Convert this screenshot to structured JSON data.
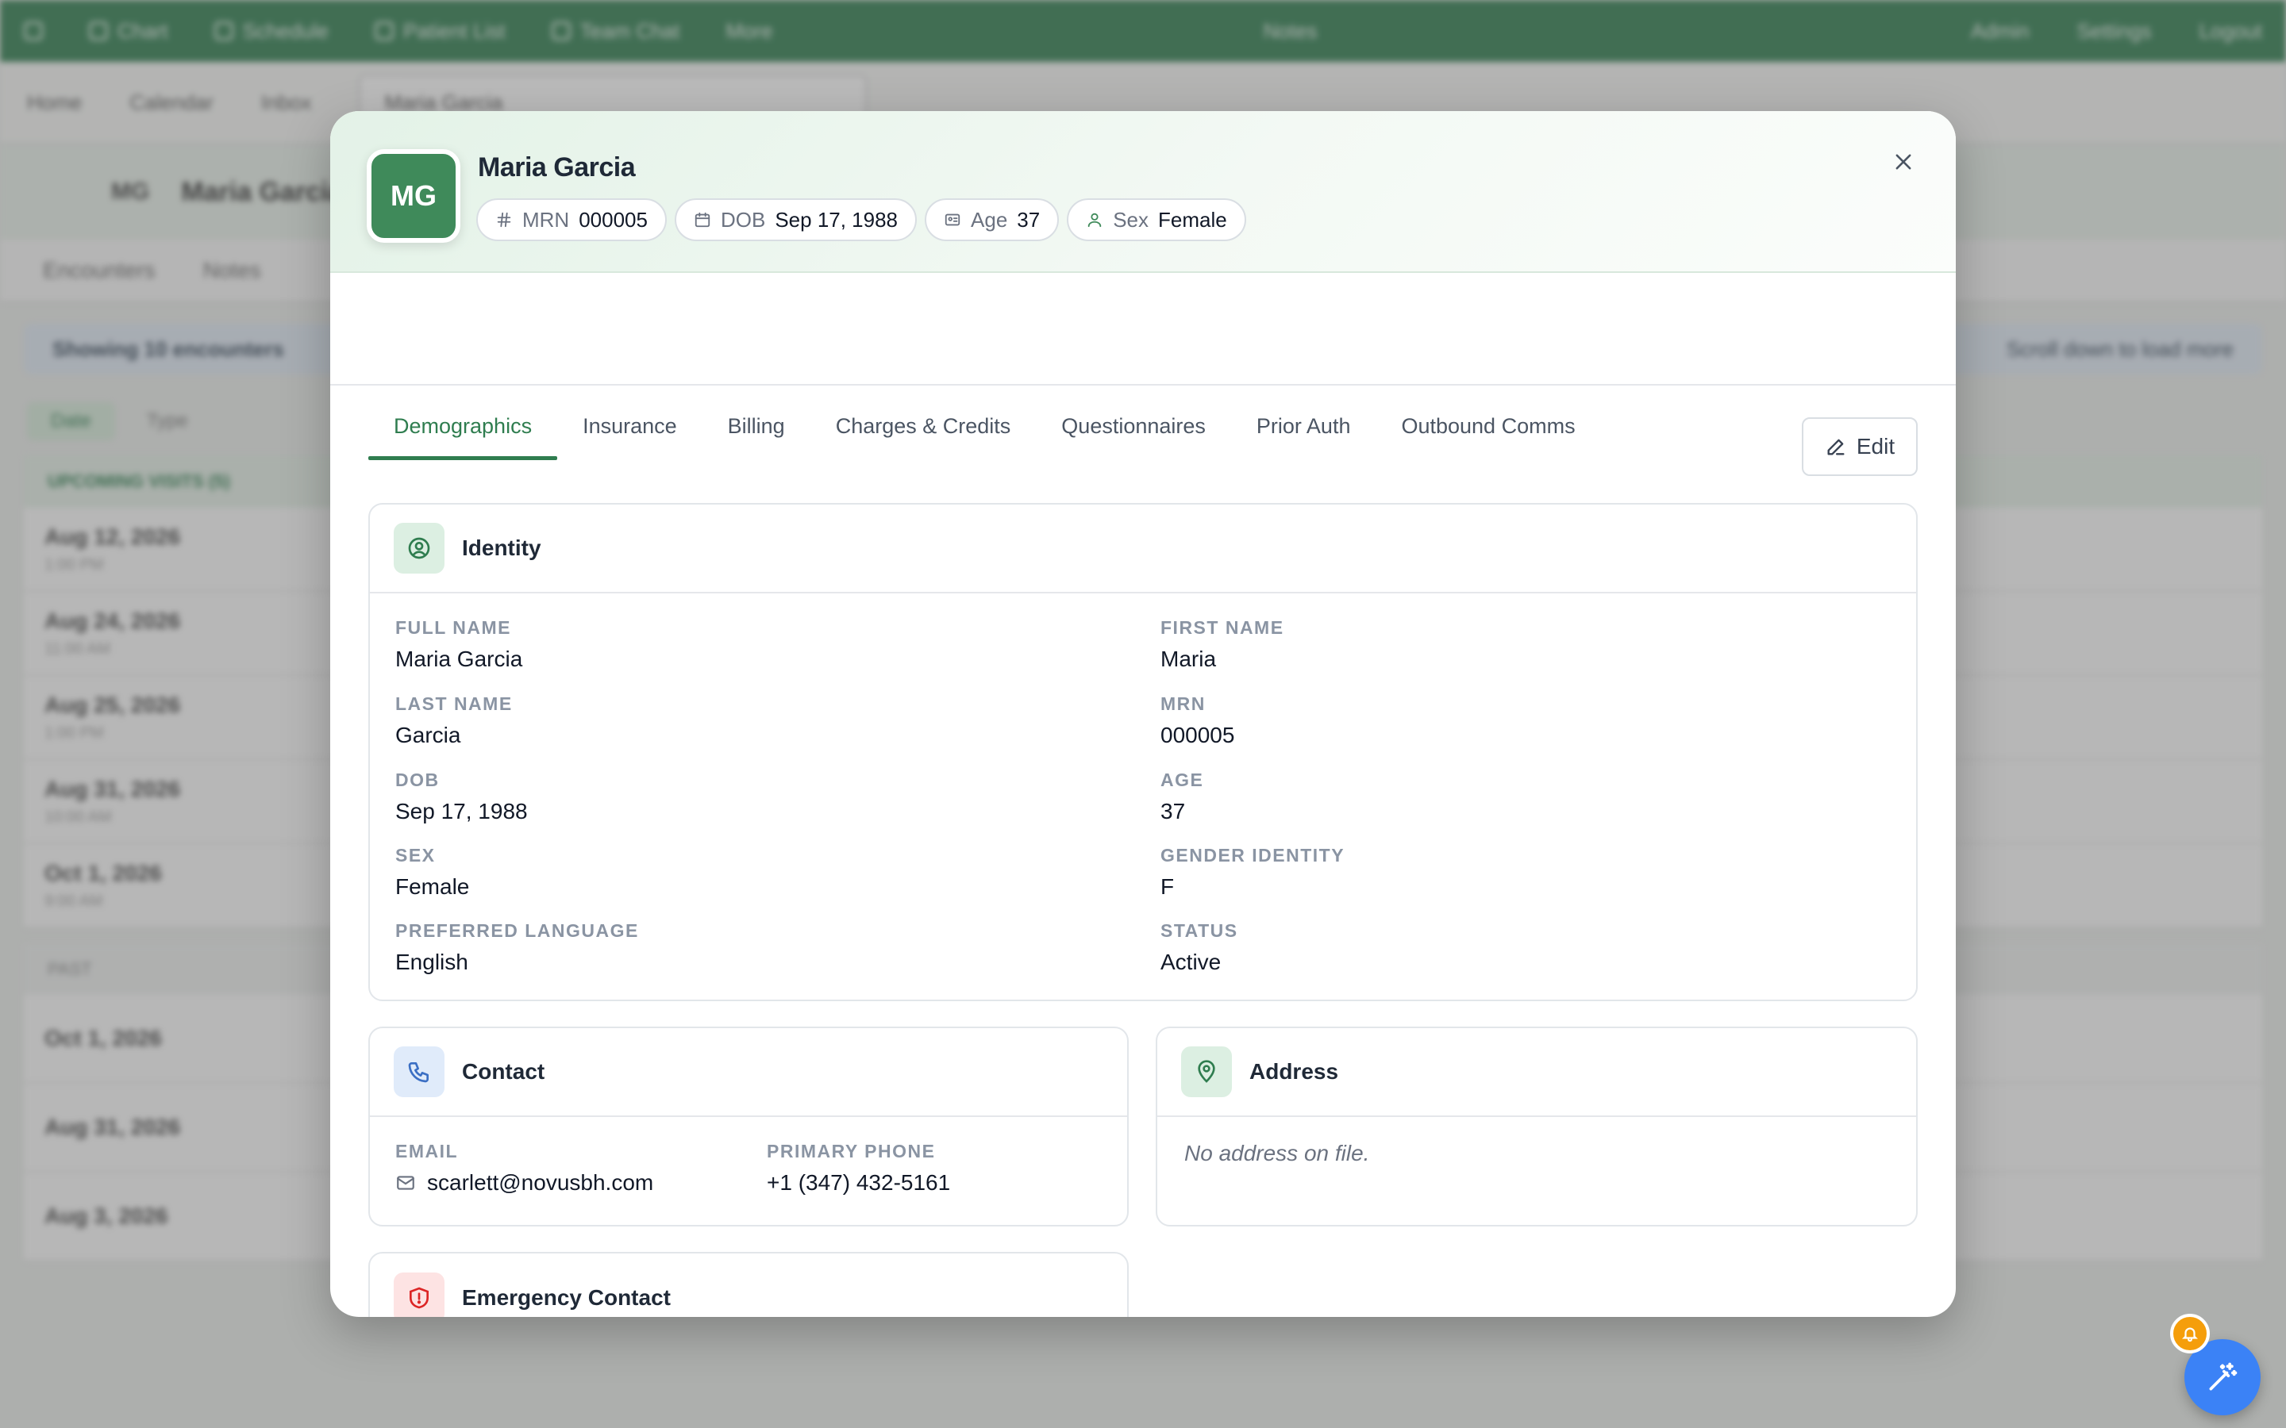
{
  "background": {
    "nav": [
      "Chart",
      "Schedule",
      "Patient List",
      "Team Chat",
      "More"
    ],
    "nav_center": "Notes",
    "nav_right": [
      "Admin",
      "Settings",
      "Logout"
    ],
    "tabs": [
      "Home",
      "Calendar",
      "Inbox"
    ],
    "active_tab": "Maria Garcia",
    "patient_name": "Maria Garcia",
    "patient_initials": "MG",
    "subtabs": [
      "Encounters",
      "Notes"
    ],
    "banner_left": "Showing 10 encounters",
    "banner_right": "Scroll down to load more",
    "filters": [
      "Date",
      "Type"
    ],
    "upcoming_header": "UPCOMING VISITS (5)",
    "upcoming_rows": [
      {
        "date": "Aug 12, 2026",
        "time": "1:00 PM"
      },
      {
        "date": "Aug 24, 2026",
        "time": "11:00 AM"
      },
      {
        "date": "Aug 25, 2026",
        "time": "1:00 PM"
      },
      {
        "date": "Aug 31, 2026",
        "time": "10:00 AM"
      },
      {
        "date": "Oct 1, 2026",
        "time": "9:00 AM"
      }
    ],
    "past_header": "PAST",
    "past_rows": [
      "Oct 1, 2026",
      "Aug 31, 2026",
      "Aug 3, 2026"
    ]
  },
  "modal": {
    "avatar_initials": "MG",
    "patient_name": "Maria Garcia",
    "chips": [
      {
        "icon": "hash-icon",
        "label": "MRN",
        "value": "000005"
      },
      {
        "icon": "calendar-icon",
        "label": "DOB",
        "value": "Sep 17, 1988"
      },
      {
        "icon": "id-card-icon",
        "label": "Age",
        "value": "37"
      },
      {
        "icon": "person-icon",
        "label": "Sex",
        "value": "Female"
      }
    ],
    "tabs": [
      "Demographics",
      "Insurance",
      "Billing",
      "Charges & Credits",
      "Questionnaires",
      "Prior Auth",
      "Outbound Comms"
    ],
    "active_tab": "Demographics",
    "edit_label": "Edit",
    "identity": {
      "title": "Identity",
      "fields": [
        {
          "label": "FULL NAME",
          "value": "Maria Garcia"
        },
        {
          "label": "FIRST NAME",
          "value": "Maria"
        },
        {
          "label": "LAST NAME",
          "value": "Garcia"
        },
        {
          "label": "MRN",
          "value": "000005"
        },
        {
          "label": "DOB",
          "value": "Sep 17, 1988"
        },
        {
          "label": "AGE",
          "value": "37"
        },
        {
          "label": "SEX",
          "value": "Female"
        },
        {
          "label": "GENDER IDENTITY",
          "value": "F"
        },
        {
          "label": "PREFERRED LANGUAGE",
          "value": "English"
        },
        {
          "label": "STATUS",
          "value": "Active"
        }
      ]
    },
    "contact": {
      "title": "Contact",
      "email_label": "EMAIL",
      "email": "scarlett@novusbh.com",
      "phone_label": "PRIMARY PHONE",
      "phone": "+1 (347) 432-5161"
    },
    "address": {
      "title": "Address",
      "empty_text": "No address on file."
    },
    "emergency": {
      "title": "Emergency Contact"
    }
  },
  "colors": {
    "brand": "#2f7d4f",
    "avatar": "#3f8a5a",
    "fab": "#3b82f6",
    "notification": "#f59e0b"
  }
}
